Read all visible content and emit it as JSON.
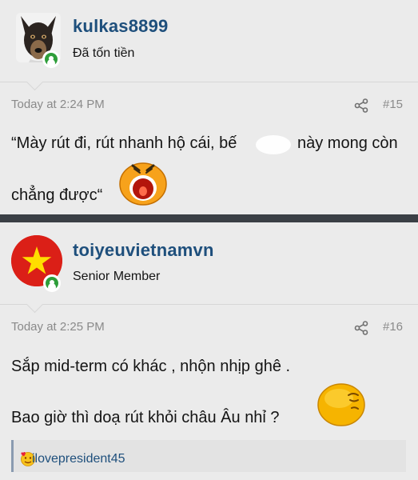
{
  "posts": [
    {
      "username": "kulkas8899",
      "user_title": "Đã tốn tiền",
      "timestamp": "Today at 2:24 PM",
      "post_number": "#15",
      "lines": [
        "“Mày rút đi, rút nhanh hộ cái, bế",
        "này mong còn",
        "chẳng được“"
      ],
      "emoji": "angry-shouting-emoji"
    },
    {
      "username": "toiyeuvietnamvn",
      "user_title": "Senior Member",
      "timestamp": "Today at 2:25 PM",
      "post_number": "#16",
      "lines": [
        "Sắp mid-term có khác , nhộn nhịp ghê .",
        "Bao giờ thì doạ rút khỏi châu Âu nhỉ ?"
      ],
      "emoji": "sleepy-emoji",
      "reaction_user": "ilovepresident45",
      "reaction_icon": "love-emoji"
    }
  ],
  "colors": {
    "username": "#1e4f7c",
    "online": "#2e9e3a",
    "divider": "#3a3f45",
    "meta": "#8a8a8a",
    "flag_red": "#db1f17",
    "flag_star": "#ffde00"
  }
}
